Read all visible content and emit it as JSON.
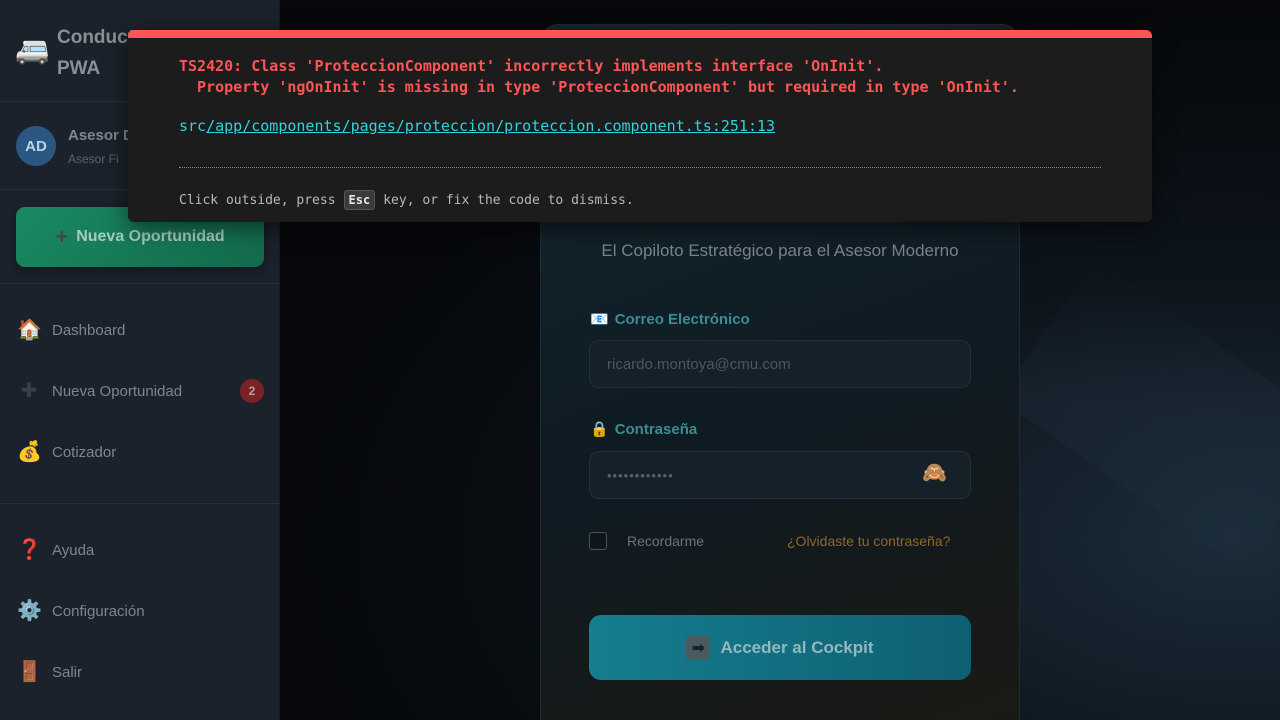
{
  "app": {
    "brand_icon": "🚐",
    "brand_name": "Conductores PWA"
  },
  "user": {
    "avatar_initials": "AD",
    "name": "Asesor D",
    "role": "Asesor Fi"
  },
  "sidebar": {
    "primary_button": {
      "icon": "+",
      "label": "Nueva Oportunidad"
    },
    "nav_main": [
      {
        "icon": "🏠",
        "label": "Dashboard"
      },
      {
        "icon": "➕",
        "label": "Nueva Oportunidad",
        "badge": "2"
      },
      {
        "icon": "💰",
        "label": "Cotizador"
      }
    ],
    "nav_footer": [
      {
        "icon": "❓",
        "label": "Ayuda"
      },
      {
        "icon": "⚙️",
        "label": "Configuración"
      },
      {
        "icon": "🚪",
        "label": "Salir"
      }
    ]
  },
  "login": {
    "tagline": "El Copiloto Estratégico para el Asesor Moderno",
    "email": {
      "icon": "📧",
      "label": "Correo Electrónico",
      "placeholder": "ricardo.montoya@cmu.com"
    },
    "password": {
      "icon": "🔒",
      "label": "Contraseña",
      "value": "••••••••••••",
      "toggle_icon": "🙈"
    },
    "remember_label": "Recordarme",
    "forgot_label": "¿Olvidaste tu contraseña?",
    "submit": {
      "icon": "➡",
      "label": "Acceder al Cockpit"
    }
  },
  "error_overlay": {
    "line1": "TS2420: Class 'ProteccionComponent' incorrectly implements interface 'OnInit'.",
    "line2": "  Property 'ngOnInit' is missing in type 'ProteccionComponent' but required in type 'OnInit'.",
    "file_prefix": "src",
    "file_path": "/app/components/pages/proteccion/proteccion.component.ts:251:13",
    "tip_before": "Click outside, press",
    "tip_key": "Esc",
    "tip_after": "key, or fix the code to dismiss."
  },
  "colors": {
    "error_red": "#ff5555",
    "link_cyan": "#2dd4da",
    "primary_green": "#1a8a62",
    "cta_teal": "#157e8f"
  }
}
